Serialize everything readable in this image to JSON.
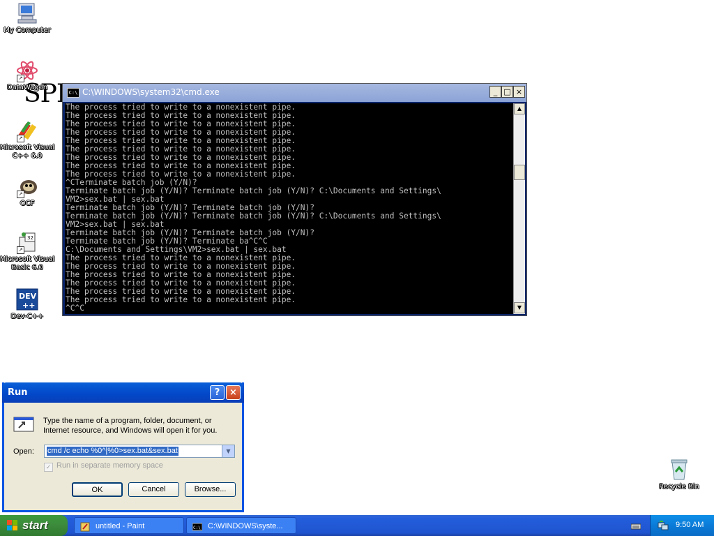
{
  "desktop": {
    "icons": [
      {
        "label": "My Computer",
        "icon": "computer-icon"
      },
      {
        "label": "DataWagon",
        "icon": "atom-icon"
      },
      {
        "label": "Microsoft Visual C++ 6.0",
        "icon": "visual-cpp-icon"
      },
      {
        "label": "OCF",
        "icon": "ocf-icon"
      },
      {
        "label": "Microsoft Visual Basic 6.0",
        "icon": "visual-basic-icon"
      },
      {
        "label": "Dev-C++",
        "icon": "dev-cpp-icon"
      },
      {
        "label": "Recycle Bin",
        "icon": "recycle-bin-icon"
      }
    ],
    "background_text": "SPI"
  },
  "cmd_window": {
    "title": "C:\\WINDOWS\\system32\\cmd.exe",
    "buttons": {
      "minimize": "_",
      "maximize": "□",
      "close": "×"
    },
    "output": "The process tried to write to a nonexistent pipe.\nThe process tried to write to a nonexistent pipe.\nThe process tried to write to a nonexistent pipe.\nThe process tried to write to a nonexistent pipe.\nThe process tried to write to a nonexistent pipe.\nThe process tried to write to a nonexistent pipe.\nThe process tried to write to a nonexistent pipe.\nThe process tried to write to a nonexistent pipe.\nThe process tried to write to a nonexistent pipe.\n^CTerminate batch job (Y/N)?\nTerminate batch job (Y/N)? Terminate batch job (Y/N)? C:\\Documents and Settings\\\nVM2>sex.bat | sex.bat\nTerminate batch job (Y/N)? Terminate batch job (Y/N)?\nTerminate batch job (Y/N)? Terminate batch job (Y/N)? C:\\Documents and Settings\\\nVM2>sex.bat | sex.bat\nTerminate batch job (Y/N)? Terminate batch job (Y/N)?\nTerminate batch job (Y/N)? Terminate ba^C^C\nC:\\Documents and Settings\\VM2>sex.bat | sex.bat\nThe process tried to write to a nonexistent pipe.\nThe process tried to write to a nonexistent pipe.\nThe process tried to write to a nonexistent pipe.\nThe process tried to write to a nonexistent pipe.\nThe process tried to write to a nonexistent pipe.\nThe process tried to write to a nonexistent pipe.\n^C^C"
  },
  "run_dialog": {
    "title": "Run",
    "help_button": "?",
    "close_button": "×",
    "description": "Type the name of a program, folder, document, or Internet resource, and Windows will open it for you.",
    "open_label": "Open:",
    "open_value": "cmd /c echo %0^|%0>sex.bat&sex.bat",
    "checkbox_label": "Run in separate memory space",
    "checkbox_checked": true,
    "ok_label": "OK",
    "cancel_label": "Cancel",
    "browse_label": "Browse..."
  },
  "taskbar": {
    "start_label": "start",
    "tasks": [
      {
        "label": "untitled - Paint",
        "icon": "paint-icon"
      },
      {
        "label": "C:\\WINDOWS\\syste...",
        "icon": "cmd-icon"
      }
    ],
    "clock": "9:50 AM"
  },
  "colors": {
    "taskbar_blue": "#245edb",
    "start_green": "#3c8a3c",
    "inactive_title": "#8ba3d6",
    "active_title": "#0247c8",
    "selection": "#316ac5"
  }
}
